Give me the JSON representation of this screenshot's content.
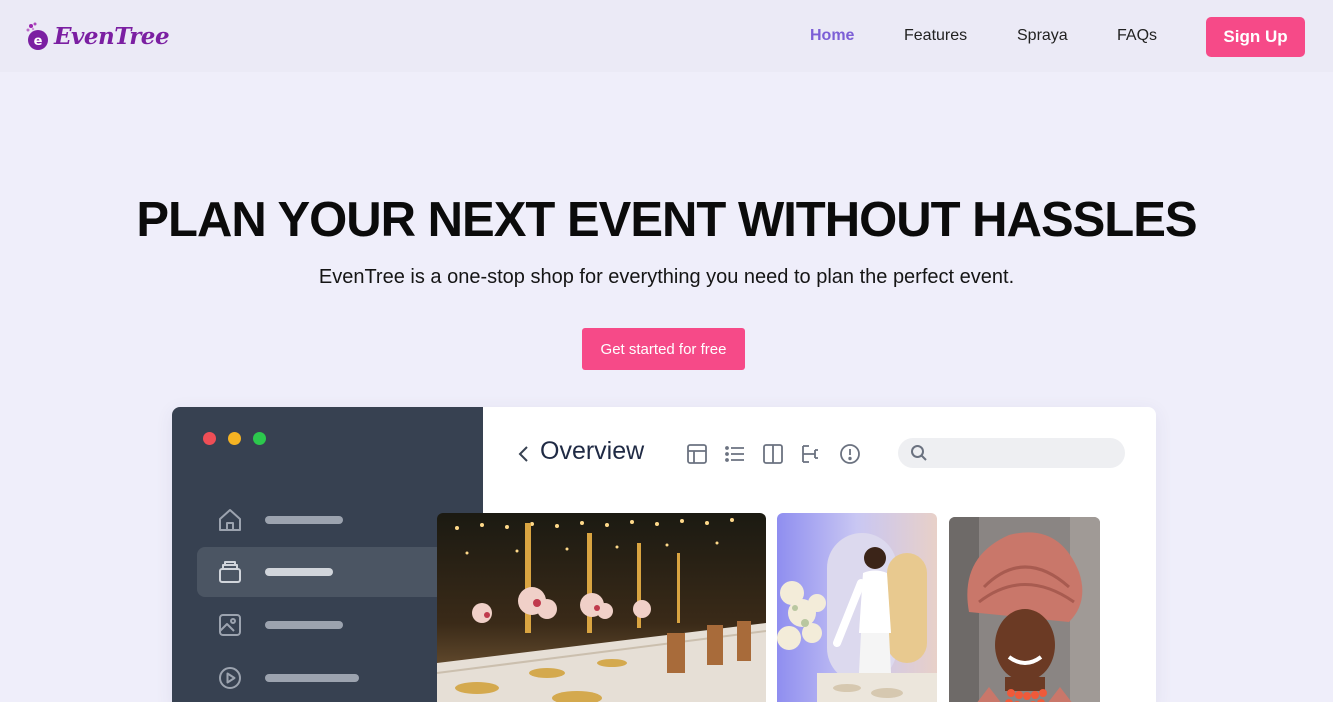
{
  "brand": {
    "name": "EvenTree"
  },
  "nav": {
    "links": [
      {
        "label": "Home",
        "active": true
      },
      {
        "label": "Features",
        "active": false
      },
      {
        "label": "Spraya",
        "active": false
      },
      {
        "label": "FAQs",
        "active": false
      }
    ],
    "signup_label": "Sign Up"
  },
  "hero": {
    "title": "PLAN YOUR NEXT EVENT WITHOUT HASSLES",
    "subtitle": "EvenTree is a one-stop shop for everything you need to plan the perfect event.",
    "cta_label": "Get started for free"
  },
  "mockup": {
    "title": "Overview",
    "sidebar_items": [
      {
        "icon": "home-icon",
        "active": false
      },
      {
        "icon": "inbox-icon",
        "active": true
      },
      {
        "icon": "image-icon",
        "active": false
      },
      {
        "icon": "play-icon",
        "active": false
      }
    ],
    "toolbar_icons": [
      "table-icon",
      "list-icon",
      "columns-icon",
      "hierarchy-icon",
      "info-icon"
    ],
    "search_placeholder": "",
    "photos": [
      "banquet-table-photo",
      "table-setting-photo",
      "woman-gele-portrait-photo"
    ]
  },
  "colors": {
    "accent_pink": "#f64a88",
    "brand_purple": "#7b1fa2",
    "nav_active": "#7c5fd6",
    "sidebar_bg": "#374151",
    "page_bg": "#efeefa"
  }
}
